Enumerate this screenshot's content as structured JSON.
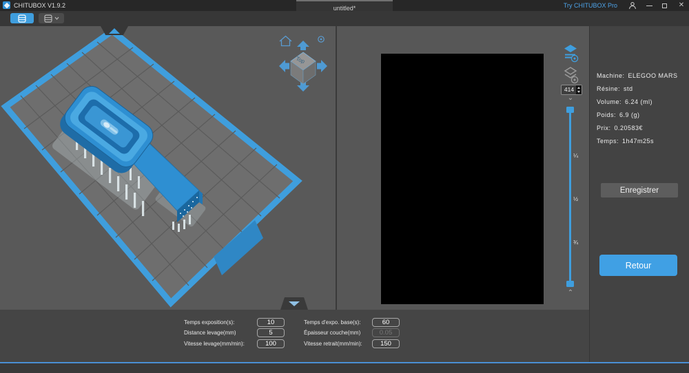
{
  "titlebar": {
    "app_title": "CHITUBOX V1.9.2",
    "document_tab": "untitled*",
    "try_pro": "Try CHITUBOX Pro",
    "close_glyph": "✕"
  },
  "viewport": {
    "cube_top_label": "Top"
  },
  "preview": {
    "layer_spin_value": "414",
    "chevron_down": "⌄",
    "chevron_up": "⌃",
    "fractions": [
      "¼",
      "½",
      "¾"
    ]
  },
  "info_panel": {
    "rows": [
      {
        "label": "Machine:",
        "value": "ELEGOO MARS"
      },
      {
        "label": "Résine:",
        "value": "std"
      },
      {
        "label": "Volume:",
        "value": "6.24  (ml)"
      },
      {
        "label": "Poids:",
        "value": "6.9  (g)"
      },
      {
        "label": "Prix:",
        "value": "0.20583€"
      },
      {
        "label": "Temps:",
        "value": "1h47m25s"
      }
    ],
    "save_label": "Enregistrer",
    "back_label": "Retour"
  },
  "settings": {
    "columns": [
      {
        "rows": [
          {
            "label": "Temps exposition(s):",
            "value": "10"
          },
          {
            "label": "Distance levage(mm)",
            "value": "5"
          },
          {
            "label": "Vitesse levage(mm/min):",
            "value": "100"
          }
        ]
      },
      {
        "rows": [
          {
            "label": "Temps d'expo. base(s):",
            "value": "60"
          },
          {
            "label": "Épaisseur couche(mm)",
            "value": "0.05"
          },
          {
            "label": "Vitesse retrait(mm/min):",
            "value": "150"
          }
        ]
      }
    ]
  },
  "colors": {
    "accent_blue": "#3f9ede",
    "plate_blue": "#3f9edd",
    "model_blue": "#2e8fd2",
    "panel_dark": "#434343",
    "viewport_gray": "#595959",
    "slice_background": "#000000"
  }
}
